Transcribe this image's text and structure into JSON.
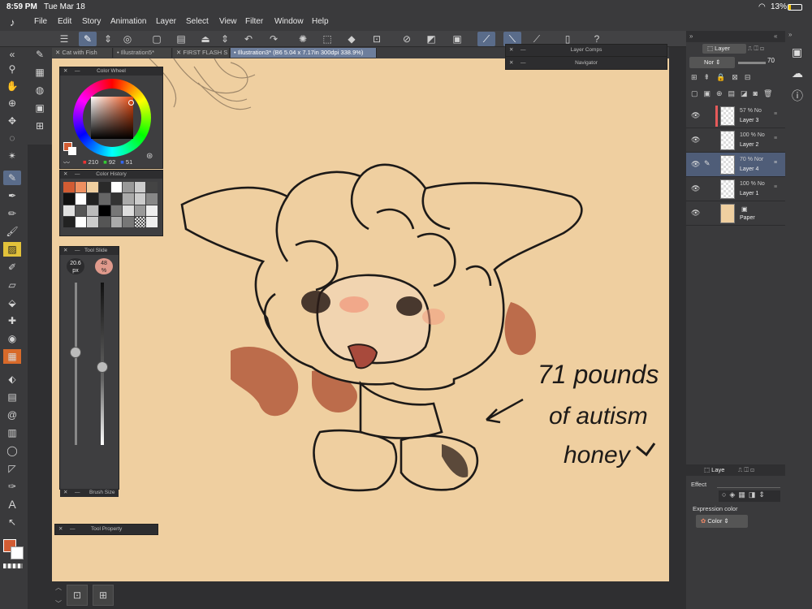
{
  "status": {
    "time": "8:59 PM",
    "date": "Tue Mar 18",
    "battery": "13%"
  },
  "menu": [
    "File",
    "Edit",
    "Story",
    "Animation",
    "Layer",
    "Select",
    "View",
    "Filter",
    "Window",
    "Help"
  ],
  "tabs": [
    {
      "label": "Cat with Fish",
      "active": false
    },
    {
      "label": "Illustration5*",
      "active": false
    },
    {
      "label": "FIRST FLASH S",
      "active": false
    },
    {
      "label": "Illustration3* (B6 5.04 x 7.17in 300dpi 338.9%)",
      "active": true
    }
  ],
  "panels": {
    "color_wheel": "Color Wheel",
    "color_history": "Color History",
    "tool_slider": "Tool Slide",
    "brush_size": "Brush Size",
    "tool_property": "Tool Property",
    "layer_comps": "Layer Comps",
    "navigator": "Navigator"
  },
  "color_values": {
    "r": "210",
    "g": "92",
    "b": "51"
  },
  "colors": {
    "main": "#d25c33",
    "sub": "#ffffff",
    "canvas": "#efcfa0",
    "accent": "#5a6c8a"
  },
  "tool_slider": {
    "size": "20.6",
    "size_unit": "px",
    "opacity": "48",
    "opacity_unit": "%",
    "size_level": 0.57,
    "opacity_level": 0.48
  },
  "layer_panel": {
    "title": "Layer",
    "blend": "Nor",
    "opacity": "70",
    "layers": [
      {
        "pct": "57 %",
        "mode": "No",
        "name": "Layer 3",
        "selected": false
      },
      {
        "pct": "100 %",
        "mode": "No",
        "name": "Layer 2",
        "selected": false
      },
      {
        "pct": "70 %",
        "mode": "Nor",
        "name": "Layer 4",
        "selected": true
      },
      {
        "pct": "100 %",
        "mode": "No",
        "name": "Layer 1",
        "selected": false
      },
      {
        "pct": "",
        "mode": "",
        "name": "Paper",
        "selected": false
      }
    ]
  },
  "layer_property": {
    "tab": "Laye",
    "effect_label": "Effect",
    "expression_label": "Expression color",
    "expression_value": "Color"
  },
  "artwork": {
    "caption_line1": "71 pounds",
    "caption_line2": "of autism",
    "caption_line3": "honey"
  }
}
